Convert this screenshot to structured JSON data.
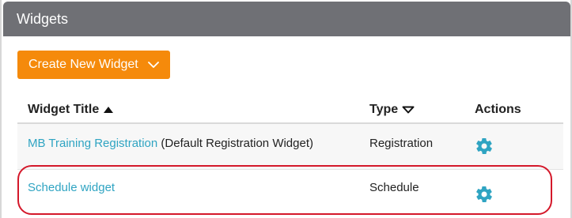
{
  "header": {
    "title": "Widgets"
  },
  "toolbar": {
    "create_label": "Create New Widget",
    "create_icon": "chevron-down-icon"
  },
  "table": {
    "columns": [
      {
        "label": "Widget Title",
        "sort": "ascending",
        "icon": "sort-up-triangle-icon"
      },
      {
        "label": "Type",
        "sort": "none",
        "icon": "sort-down-outline-triangle-icon"
      },
      {
        "label": "Actions"
      }
    ],
    "rows": [
      {
        "title": "MB Training Registration",
        "note": "(Default Registration Widget)",
        "type": "Registration",
        "action_icon": "gear-icon"
      },
      {
        "title": "Schedule widget",
        "note": "",
        "type": "Schedule",
        "action_icon": "gear-icon",
        "highlighted": true
      }
    ]
  },
  "colors": {
    "header_bg": "#6f7075",
    "accent_button": "#f58a0b",
    "link": "#2fa4c2",
    "gear": "#2fa4c2",
    "highlight_outline": "#d4182a"
  }
}
